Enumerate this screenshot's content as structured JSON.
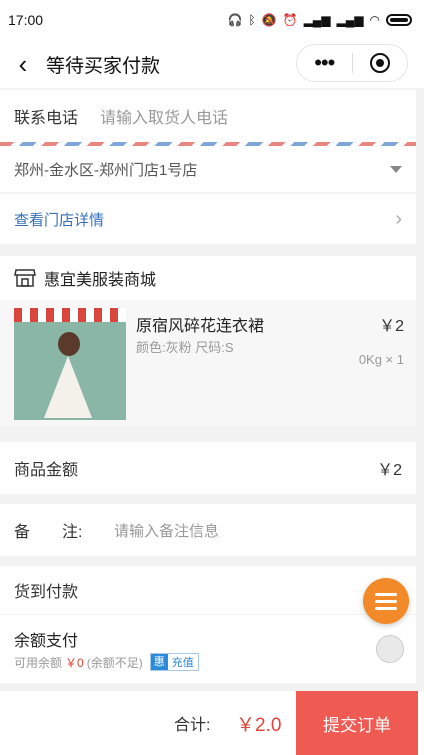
{
  "status_bar": {
    "time": "17:00"
  },
  "nav": {
    "title": "等待买家付款",
    "more_label": "•••"
  },
  "contact": {
    "label": "联系电话",
    "placeholder": "请输入取货人电话"
  },
  "store": {
    "selected": "郑州-金水区-郑州门店1号店",
    "detail_link": "查看门店详情"
  },
  "shop": {
    "name": "惠宜美服装商城"
  },
  "goods": [
    {
      "name": "原宿风碎花连衣裙",
      "spec": "颜色:灰粉 尺码:S",
      "price": "￥2",
      "qty": "0Kg × 1"
    }
  ],
  "amount": {
    "label": "商品金额",
    "value": "￥2"
  },
  "remark": {
    "label": "备　　注:",
    "placeholder": "请输入备注信息"
  },
  "cod": {
    "label": "货到付款"
  },
  "balance": {
    "title": "余额支付",
    "available_label": "可用余额",
    "available_value": "￥0",
    "insufficient": "(余额不足)",
    "recharge_icon": "惠",
    "recharge_label": "充值"
  },
  "footer": {
    "total_label": "合计:",
    "total_value": "￥2.0",
    "submit_label": "提交订单"
  },
  "colors": {
    "accent_red": "#ef5a52",
    "link_blue": "#3570b8",
    "fab_orange": "#f28a2a"
  }
}
